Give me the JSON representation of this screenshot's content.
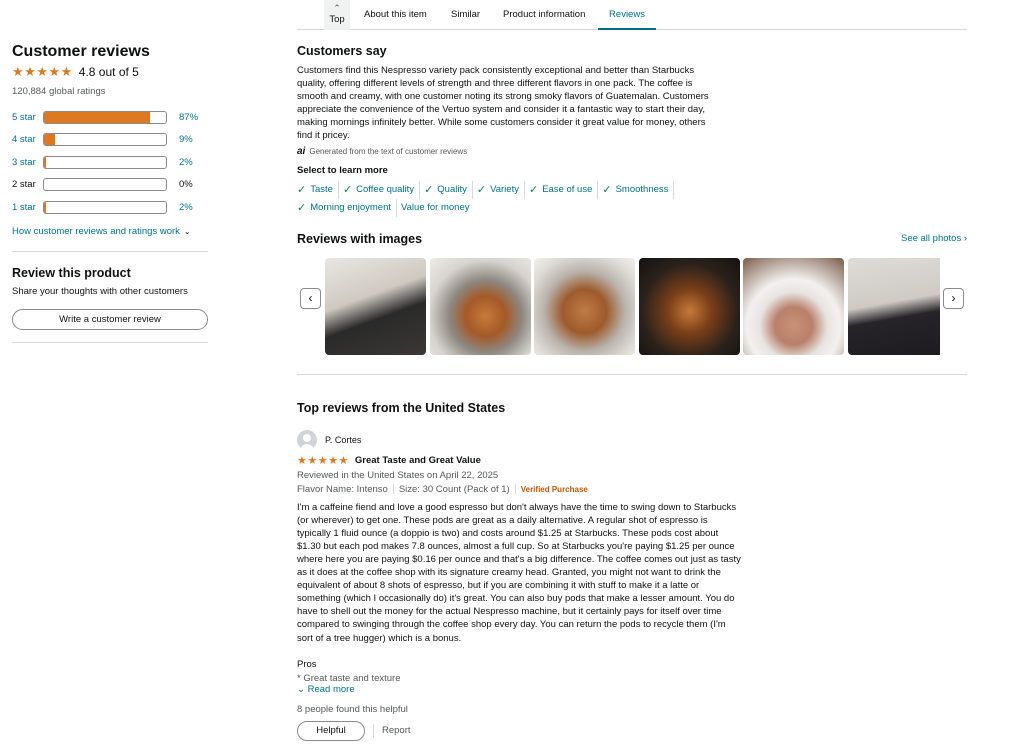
{
  "nav": {
    "top_label": "Top",
    "about": "About this item",
    "similar": "Similar",
    "product_info": "Product information",
    "reviews": "Reviews"
  },
  "left": {
    "heading": "Customer reviews",
    "rating": 4.8,
    "rating_text": "4.8 out of 5",
    "global_ratings": "120,884 global ratings",
    "histogram": [
      {
        "label": "5 star",
        "percent": 87,
        "percent_text": "87%"
      },
      {
        "label": "4 star",
        "percent": 9,
        "percent_text": "9%"
      },
      {
        "label": "3 star",
        "percent": 2,
        "percent_text": "2%"
      },
      {
        "label": "2 star",
        "percent": 0,
        "percent_text": "0%"
      },
      {
        "label": "1 star",
        "percent": 2,
        "percent_text": "2%"
      }
    ],
    "how_link": "How customer reviews and ratings work",
    "review_heading": "Review this product",
    "share_text": "Share your thoughts with other customers",
    "write_button": "Write a customer review"
  },
  "customers_say": {
    "heading": "Customers say",
    "summary": "Customers find this Nespresso variety pack consistently exceptional and better than Starbucks quality, offering different levels of strength and three different flavors in one pack. The coffee is smooth and creamy, with one customer noting its strong smoky flavors of Guatemalan. Customers appreciate the convenience of the Vertuo system and consider it a fantastic way to start their day, making mornings infinitely better. While some customers consider it great value for money, others find it pricey.",
    "ai_mark": "ai",
    "generated_note": "Generated from the text of customer reviews",
    "select_label": "Select to learn more",
    "chips": [
      "Taste",
      "Coffee quality",
      "Quality",
      "Variety",
      "Ease of use",
      "Smoothness",
      "Morning enjoyment",
      "Value for money"
    ]
  },
  "images_section": {
    "heading": "Reviews with images",
    "see_all": "See all photos ›"
  },
  "top_reviews": {
    "heading": "Top reviews from the United States",
    "review": {
      "name": "P. Cortes",
      "stars": 5,
      "title": "Great Taste and Great Value",
      "date": "Reviewed in the United States on April 22, 2025",
      "flavor": "Flavor Name: Intenso",
      "size": "Size: 30 Count (Pack of 1)",
      "verified": "Verified Purchase",
      "body": "I'm a caffeine fiend and love a good espresso but don't always have the time to swing down to Starbucks (or wherever) to get one. These pods are great as a daily alternative. A regular shot of espresso is typically 1 fluid ounce (a doppio is two) and costs around $1.25 at Starbucks. These pods cost about $1.30 but each pod makes 7.8 ounces, almost a full cup. So at Starbucks you're paying $1.25 per ounce where here you are paying $0.16 per ounce and that's a big difference. The coffee comes out just as tasty as it does at the coffee shop with its signature creamy head. Granted, you might not want to drink the equivalent of about 8 shots of espresso, but if you are combining it with stuff to make it a latte or something (which I occasionally do) it's great. You can also buy pods that make a lesser amount. You do have to shell out the money for the actual Nespresso machine, but it certainly pays for itself over time compared to swinging through the coffee shop every day. You can return the pods to recycle them (I'm sort of a tree hugger) which is a bonus.",
      "pros_label": "Pros",
      "pros_item": "* Great taste and texture",
      "read_more": "Read more",
      "helpful_count": "8 people found this helpful",
      "helpful_button": "Helpful",
      "report": "Report"
    }
  }
}
